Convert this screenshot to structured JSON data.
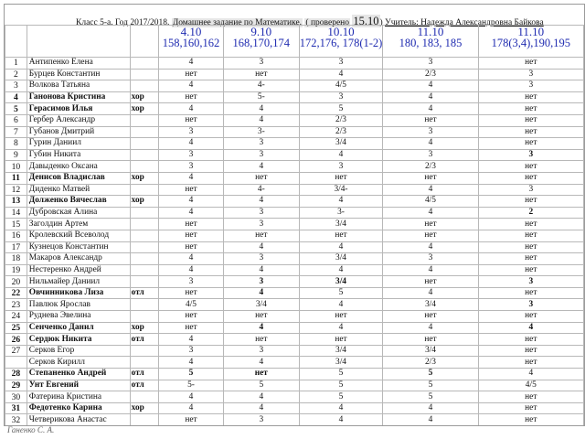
{
  "title": {
    "klass": "Класс 5-а. Год 2017/2018.",
    "task": "Домашнее задание по Математике.",
    "checked": "( проверено",
    "checked_date": "15.10",
    "suffix": ")",
    "teacher": "Учитель: Надежда Александровна Байкова"
  },
  "columns": [
    {
      "date": "4.10",
      "task": "158,160,162"
    },
    {
      "date": "9.10",
      "task": "168,170,174"
    },
    {
      "date": "10.10",
      "task": "172,176, 178(1-2)"
    },
    {
      "date": "11.10",
      "task": "180, 183, 185"
    },
    {
      "date": "11.10",
      "task": "178(3,4),190,195"
    }
  ],
  "rows": [
    {
      "n": "1",
      "name": "Антипенко Елена",
      "note": "",
      "c": [
        "4",
        "3",
        "3",
        "3",
        "нет"
      ],
      "style": "",
      "cs": [
        "",
        "",
        "",
        "",
        ""
      ]
    },
    {
      "n": "2",
      "name": "Бурцев Константин",
      "note": "",
      "c": [
        "нет",
        "нет",
        "4",
        "2/3",
        "3"
      ],
      "style": "",
      "cs": [
        "",
        "",
        "",
        "",
        ""
      ]
    },
    {
      "n": "3",
      "name": "Волкова Татьяна",
      "note": "",
      "c": [
        "4",
        "4-",
        "4/5",
        "4",
        "3"
      ],
      "style": "",
      "cs": [
        "",
        "",
        "",
        "",
        ""
      ]
    },
    {
      "n": "4",
      "name": "Ганонова Кристина",
      "note": "хор",
      "c": [
        "нет",
        "5-",
        "3",
        "4",
        "нет"
      ],
      "style": "sb",
      "cs": [
        "",
        "",
        "",
        "",
        ""
      ]
    },
    {
      "n": "5",
      "name": "Герасимов Илья",
      "note": "хор",
      "c": [
        "4",
        "4",
        "5",
        "4",
        "нет"
      ],
      "style": "sb",
      "cs": [
        "",
        "",
        "",
        "",
        ""
      ]
    },
    {
      "n": "6",
      "name": "Гербер Александр",
      "note": "",
      "c": [
        "нет",
        "4",
        "2/3",
        "нет",
        "нет"
      ],
      "style": "",
      "cs": [
        "",
        "",
        "",
        "",
        ""
      ]
    },
    {
      "n": "7",
      "name": "Губанов Дмитрий",
      "note": "",
      "c": [
        "3",
        "3-",
        "2/3",
        "3",
        "нет"
      ],
      "style": "",
      "cs": [
        "",
        "",
        "",
        "",
        ""
      ]
    },
    {
      "n": "8",
      "name": "Гурин Даниил",
      "note": "",
      "c": [
        "4",
        "3",
        "3/4",
        "4",
        "нет"
      ],
      "style": "",
      "cs": [
        "",
        "",
        "",
        "",
        ""
      ]
    },
    {
      "n": "9",
      "name": "Губин Никита",
      "note": "",
      "c": [
        "3",
        "3",
        "4",
        "3",
        "3"
      ],
      "style": "",
      "cs": [
        "",
        "",
        "",
        "",
        "redb"
      ]
    },
    {
      "n": "10",
      "name": "Давыденко Оксана",
      "note": "",
      "c": [
        "3",
        "4",
        "3",
        "2/3",
        "нет"
      ],
      "style": "",
      "cs": [
        "",
        "",
        "",
        "",
        ""
      ]
    },
    {
      "n": "11",
      "name": "Денисов Владислав",
      "note": "хор",
      "c": [
        "4",
        "нет",
        "нет",
        "нет",
        "нет"
      ],
      "style": "sb",
      "cs": [
        "",
        "",
        "",
        "",
        ""
      ]
    },
    {
      "n": "12",
      "name": "Диденко Матвей",
      "note": "",
      "c": [
        "нет",
        "4-",
        "3/4-",
        "4",
        "3"
      ],
      "style": "",
      "cs": [
        "",
        "",
        "",
        "",
        ""
      ]
    },
    {
      "n": "13",
      "name": "Долженко Вячеслав",
      "note": "хор",
      "c": [
        "4",
        "4",
        "4",
        "4/5",
        "нет"
      ],
      "style": "sb",
      "cs": [
        "",
        "",
        "",
        "",
        ""
      ]
    },
    {
      "n": "14",
      "name": "Дубровская Алина",
      "note": "",
      "c": [
        "4",
        "3",
        "3-",
        "4",
        "2"
      ],
      "style": "",
      "cs": [
        "",
        "",
        "",
        "",
        "redb"
      ]
    },
    {
      "n": "15",
      "name": "Заголдин Артем",
      "note": "",
      "c": [
        "нет",
        "3",
        "3/4",
        "нет",
        "нет"
      ],
      "style": "",
      "cs": [
        "",
        "",
        "",
        "",
        ""
      ]
    },
    {
      "n": "16",
      "name": "Кролевский Всеволод",
      "note": "",
      "c": [
        "нет",
        "нет",
        "нет",
        "нет",
        "нет"
      ],
      "style": "",
      "cs": [
        "",
        "",
        "",
        "",
        ""
      ]
    },
    {
      "n": "17",
      "name": "Кузнецов Константин",
      "note": "",
      "c": [
        "нет",
        "4",
        "4",
        "4",
        "нет"
      ],
      "style": "",
      "cs": [
        "",
        "",
        "",
        "",
        ""
      ]
    },
    {
      "n": "18",
      "name": "Макаров Александр",
      "note": "",
      "c": [
        "4",
        "3",
        "3/4",
        "3",
        "нет"
      ],
      "style": "",
      "cs": [
        "",
        "",
        "",
        "",
        ""
      ]
    },
    {
      "n": "19",
      "name": "Нестеренко Андрей",
      "note": "",
      "c": [
        "4",
        "4",
        "4",
        "4",
        "нет"
      ],
      "style": "",
      "cs": [
        "",
        "",
        "",
        "",
        ""
      ]
    },
    {
      "n": "20",
      "name": "Нильмайер Даниил",
      "note": "",
      "c": [
        "3",
        "3",
        "3/4",
        "нет",
        "3"
      ],
      "style": "",
      "cs": [
        "",
        "redb",
        "redb",
        "",
        "redb"
      ]
    },
    {
      "n": "22",
      "name": "Овчинникова Лиза",
      "note": "отл",
      "c": [
        "нет",
        "4",
        "5",
        "4",
        "нет"
      ],
      "style": "sr",
      "cs": [
        "",
        "redb",
        "",
        "",
        ""
      ]
    },
    {
      "n": "23",
      "name": "Павлюк Ярослав",
      "note": "",
      "c": [
        "4/5",
        "3/4",
        "4",
        "3/4",
        "3"
      ],
      "style": "",
      "cs": [
        "",
        "",
        "",
        "",
        "redb"
      ]
    },
    {
      "n": "24",
      "name": "Руднева Эвелина",
      "note": "",
      "c": [
        "нет",
        "нет",
        "нет",
        "нет",
        "нет"
      ],
      "style": "",
      "cs": [
        "",
        "",
        "",
        "",
        ""
      ]
    },
    {
      "n": "25",
      "name": "Сенченко Данил",
      "note": "хор",
      "c": [
        "нет",
        "4",
        "4",
        "4",
        "4"
      ],
      "style": "sb",
      "cs": [
        "",
        "redb",
        "",
        "",
        "redb"
      ]
    },
    {
      "n": "26",
      "name": "Сердюк Никита",
      "note": "отл",
      "c": [
        "4",
        "нет",
        "нет",
        "нет",
        "нет"
      ],
      "style": "sr",
      "cs": [
        "",
        "",
        "",
        "",
        ""
      ]
    },
    {
      "n": "27",
      "name": "Серков Егор",
      "note": "",
      "c": [
        "3",
        "3",
        "3/4",
        "3/4",
        "нет"
      ],
      "style": "",
      "cs": [
        "",
        "",
        "",
        "",
        ""
      ]
    },
    {
      "n": "",
      "name": "Серков Кирилл",
      "note": "",
      "c": [
        "4",
        "4",
        "3/4",
        "2/3",
        "нет"
      ],
      "style": "",
      "cs": [
        "",
        "",
        "",
        "",
        ""
      ]
    },
    {
      "n": "28",
      "name": "Степаненко Андрей",
      "note": "отл",
      "c": [
        "5",
        "нет",
        "5",
        "5",
        "4"
      ],
      "style": "sr",
      "cs": [
        "redb",
        "redb",
        "",
        "redb",
        ""
      ]
    },
    {
      "n": "29",
      "name": "Унт Евгений",
      "note": "отл",
      "c": [
        "5-",
        "5",
        "5",
        "5",
        "4/5"
      ],
      "style": "sr",
      "cs": [
        "",
        "",
        "",
        "",
        ""
      ]
    },
    {
      "n": "30",
      "name": "Фатерина Кристина",
      "note": "",
      "c": [
        "4",
        "4",
        "5",
        "5",
        "нет"
      ],
      "style": "",
      "cs": [
        "",
        "",
        "",
        "",
        ""
      ]
    },
    {
      "n": "31",
      "name": "Федотенко Карина",
      "note": "хор",
      "c": [
        "4",
        "4",
        "4",
        "4",
        "нет"
      ],
      "style": "sb",
      "cs": [
        "",
        "",
        "",
        "",
        ""
      ]
    },
    {
      "n": "32",
      "name": "Четверикова Анастас",
      "note": "",
      "c": [
        "нет",
        "3",
        "4",
        "4",
        "нет"
      ],
      "style": "",
      "cs": [
        "",
        "",
        "",
        "",
        ""
      ]
    },
    {
      "n": "33",
      "name": "Юрченко Юлия",
      "note": "",
      "c": [
        "4",
        "4",
        "5",
        "нет",
        "нет"
      ],
      "style": "",
      "cs": [
        "",
        "",
        "",
        "",
        ""
      ]
    },
    {
      "n": "34",
      "name": "Ястребов Вадим (12/9)",
      "note": "",
      "c": [
        "4",
        "3",
        "нет",
        "нет",
        "нет"
      ],
      "style": "",
      "cs": [
        "",
        "",
        "",
        "",
        ""
      ]
    }
  ],
  "credit": "Ганенко С. А."
}
